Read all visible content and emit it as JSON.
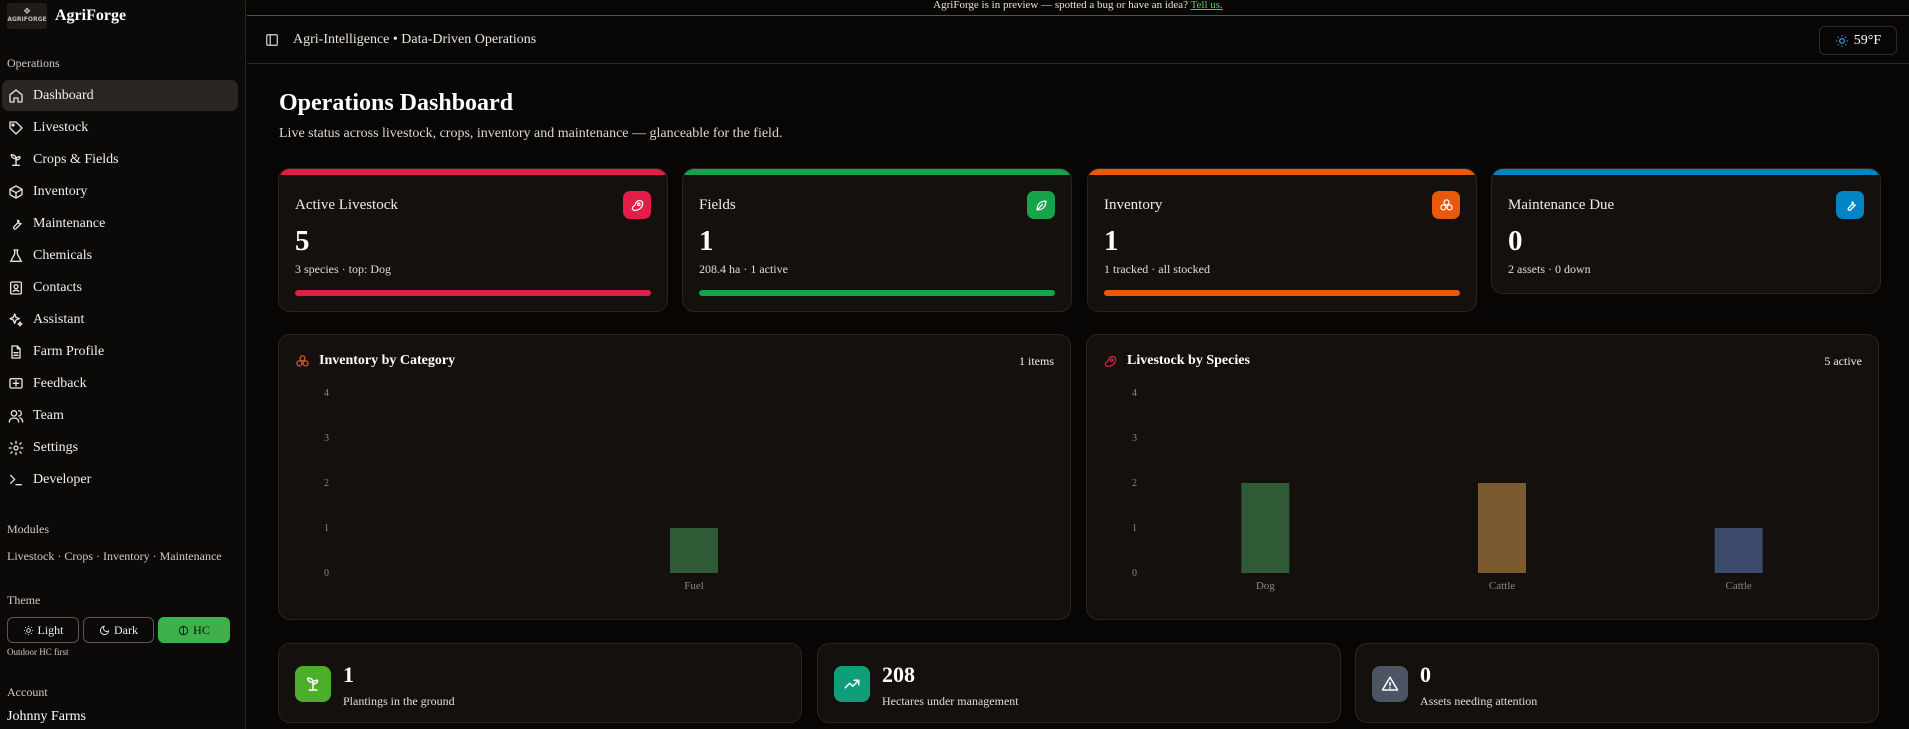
{
  "app": {
    "name": "AgriForge",
    "logo_text": "AGRIFORGE"
  },
  "sidebar": {
    "section_operations": "Operations",
    "items": [
      {
        "label": "Dashboard",
        "icon": "home-icon"
      },
      {
        "label": "Livestock",
        "icon": "tag-icon"
      },
      {
        "label": "Crops & Fields",
        "icon": "sprout-icon"
      },
      {
        "label": "Inventory",
        "icon": "box-icon"
      },
      {
        "label": "Maintenance",
        "icon": "wrench-icon"
      },
      {
        "label": "Chemicals",
        "icon": "flask-icon"
      },
      {
        "label": "Contacts",
        "icon": "contact-icon"
      },
      {
        "label": "Assistant",
        "icon": "sparkles-icon"
      },
      {
        "label": "Farm Profile",
        "icon": "file-icon"
      },
      {
        "label": "Feedback",
        "icon": "message-icon"
      },
      {
        "label": "Team",
        "icon": "users-icon"
      },
      {
        "label": "Settings",
        "icon": "gear-icon"
      },
      {
        "label": "Developer",
        "icon": "terminal-icon"
      }
    ],
    "section_modules": "Modules",
    "modules_text": "Livestock · Crops · Inventory · Maintenance",
    "section_theme": "Theme",
    "theme_light": "Light",
    "theme_dark": "Dark",
    "theme_hc": "HC",
    "theme_note": "Outdoor HC first",
    "section_account": "Account",
    "account_name": "Johnny Farms"
  },
  "banner": {
    "text": "AgriForge is in preview — spotted a bug or have an idea? ",
    "link": "Tell us."
  },
  "topbar": {
    "breadcrumb": "Agri-Intelligence • Data-Driven Operations",
    "weather": "59°F"
  },
  "page": {
    "title": "Operations Dashboard",
    "subtitle": "Live status across livestock, crops, inventory and maintenance — glanceable for the field."
  },
  "stats": [
    {
      "label": "Active Livestock",
      "value": "5",
      "detail": "3 species · top: Dog",
      "color": "#e11d48",
      "icon": "steak-icon",
      "progress": 1.0
    },
    {
      "label": "Fields",
      "value": "1",
      "detail": "208.4 ha · 1 active",
      "color": "#16a34a",
      "icon": "leaf-icon",
      "progress": 1.0
    },
    {
      "label": "Inventory",
      "value": "1",
      "detail": "1 tracked · all stocked",
      "color": "#ea580c",
      "icon": "boxes-icon",
      "progress": 1.0
    },
    {
      "label": "Maintenance Due",
      "value": "0",
      "detail": "2 assets · 0 down",
      "color": "#0284c7",
      "icon": "wrench-icon",
      "progress": 0
    }
  ],
  "charts": {
    "inventory": {
      "title": "Inventory by Category",
      "meta": "1 items"
    },
    "livestock": {
      "title": "Livestock by Species",
      "meta": "5 active"
    }
  },
  "chart_data": [
    {
      "type": "bar",
      "title": "Inventory by Category",
      "categories": [
        "Fuel"
      ],
      "values": [
        1
      ],
      "colors": [
        "#2f5a35"
      ],
      "yticks": [
        0,
        1,
        2,
        3,
        4
      ],
      "ylim": [
        0,
        4
      ]
    },
    {
      "type": "bar",
      "title": "Livestock by Species",
      "categories": [
        "Dog",
        "Cattle",
        "Cattle"
      ],
      "values": [
        2,
        2,
        1
      ],
      "colors": [
        "#2f5a35",
        "#7a5a2e",
        "#3b4a6a"
      ],
      "yticks": [
        0,
        1,
        2,
        3,
        4
      ],
      "ylim": [
        0,
        4
      ]
    }
  ],
  "summary": [
    {
      "value": "1",
      "label": "Plantings in the ground",
      "icon": "sprout-icon",
      "color": "#4caf2a"
    },
    {
      "value": "208",
      "label": "Hectares under management",
      "icon": "trending-up-icon",
      "color": "#0f9e7a"
    },
    {
      "value": "0",
      "label": "Assets needing attention",
      "icon": "alert-triangle-icon",
      "color": "#4b5563"
    }
  ]
}
